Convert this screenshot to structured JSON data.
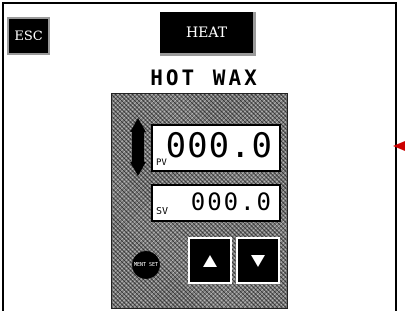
{
  "buttons": {
    "esc_label": "ESC",
    "heat_label": "HEAT"
  },
  "title": "HOT WAX",
  "controller": {
    "pv_label": "PV",
    "pv_value": "000.0",
    "sv_label": "SV",
    "sv_value": "000.0",
    "round_button_label": "MENT SET"
  },
  "icons": {
    "mode_arrow": "up-down-arrow-icon",
    "up": "triangle-up-icon",
    "down": "triangle-down-icon",
    "marker": "red-arrow-icon"
  },
  "colors": {
    "background": "#ffffff",
    "button_bg": "#000000",
    "marker": "#cc0000"
  }
}
